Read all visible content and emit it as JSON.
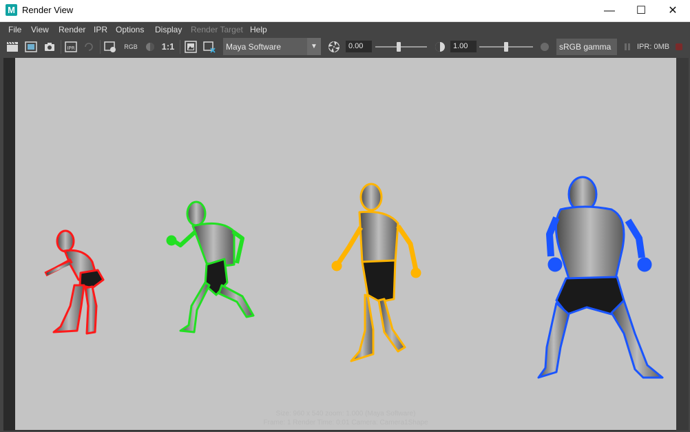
{
  "window": {
    "title": "Render View",
    "app_icon_letter": "M",
    "controls": {
      "minimize": "—",
      "maximize": "☐",
      "close": "✕"
    }
  },
  "menu": {
    "items": [
      "File",
      "View",
      "Render",
      "IPR",
      "Options",
      "Display",
      "Render Target",
      "Help"
    ]
  },
  "toolbar": {
    "rgb_label": "RGB",
    "ratio_label": "1:1",
    "renderer": "Maya Software",
    "exposure_value": "0.00",
    "gamma_value": "1.00",
    "colorspace": "sRGB gamma",
    "ipr_memory": "IPR: 0MB",
    "exposure_level": 0.45,
    "gamma_level": 0.5
  },
  "render": {
    "status_line1": "Size: 960 x 540  zoom: 1.000     (Maya Software)",
    "status_line2": "Frame: 1     Render Time: 0:01     Camera: Camera1Shape",
    "figures": [
      {
        "name": "red-crouching-figure",
        "outline_color": "#ff1a1a"
      },
      {
        "name": "green-running-figure",
        "outline_color": "#22e022"
      },
      {
        "name": "yellow-walking-figure",
        "outline_color": "#ffb400"
      },
      {
        "name": "blue-standing-figure",
        "outline_color": "#1a55ff"
      }
    ]
  }
}
